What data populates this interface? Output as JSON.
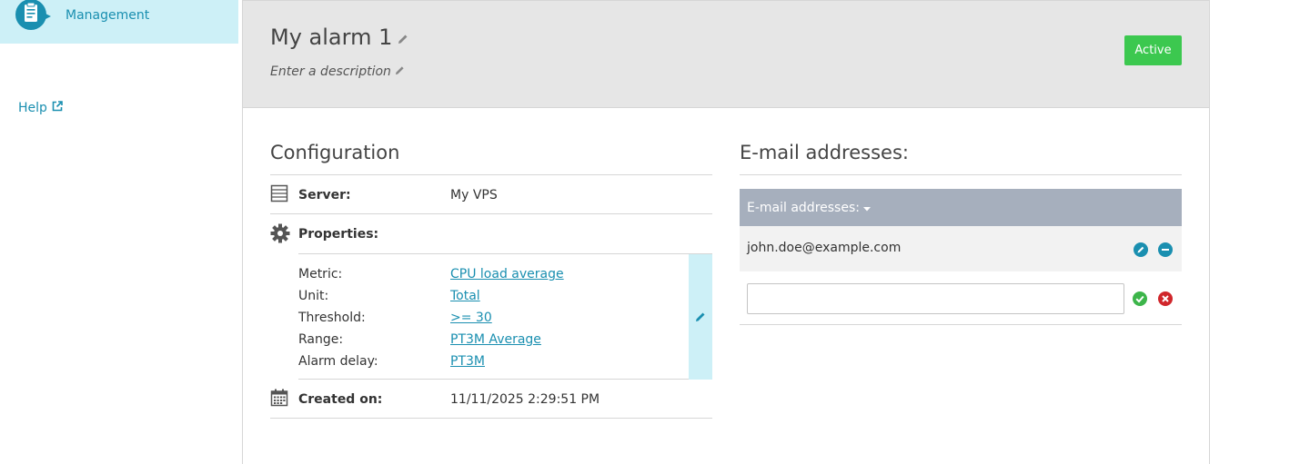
{
  "sidebar": {
    "active_item": {
      "label": "Management",
      "icon": "clipboard-icon"
    },
    "help": {
      "label": "Help",
      "icon": "external-link-icon"
    }
  },
  "alarm": {
    "title": "My alarm 1",
    "description_placeholder": "Enter a description",
    "status": "Active"
  },
  "configuration": {
    "title": "Configuration",
    "server_label": "Server:",
    "server_value": "My VPS",
    "properties_label": "Properties:",
    "properties": [
      {
        "label": "Metric:",
        "value": "CPU load average"
      },
      {
        "label": "Unit:",
        "value": "Total"
      },
      {
        "label": "Threshold:",
        "value": ">= 30"
      },
      {
        "label": "Range:",
        "value": "PT3M Average"
      },
      {
        "label": "Alarm delay:",
        "value": "PT3M"
      }
    ],
    "created_label": "Created on:",
    "created_value": "11/11/2025 2:29:51 PM"
  },
  "emails": {
    "title": "E-mail addresses:",
    "column_header": "E-mail addresses:",
    "items": [
      {
        "address": "john.doe@example.com"
      }
    ],
    "new_value": ""
  },
  "colors": {
    "accent": "#1a8fb0",
    "active_nav_bg": "#cdf0f7",
    "status_active": "#3cc84f",
    "confirm": "#3cb54a",
    "cancel": "#d0262b"
  }
}
